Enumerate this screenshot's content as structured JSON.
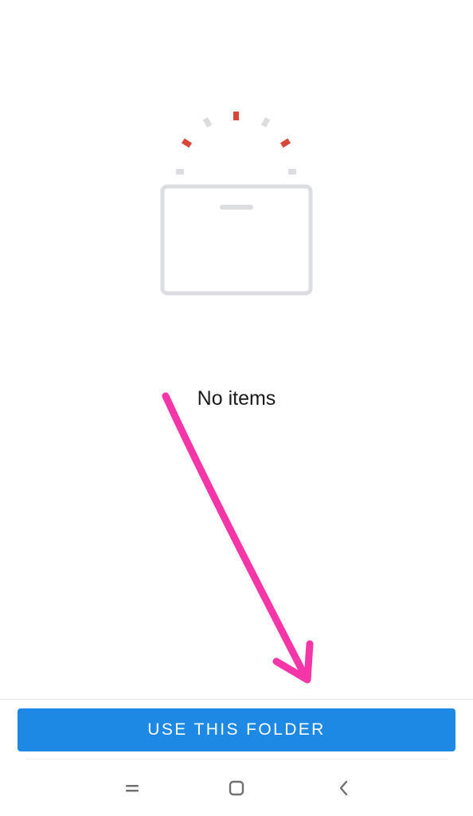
{
  "empty_state": {
    "message": "No items",
    "illustration_icon": "empty-folder-illustration-icon",
    "colors": {
      "outline": "#dcdde0",
      "accent": "#d9463a"
    }
  },
  "primary_action": {
    "label": "USE THIS FOLDER",
    "color": "#1e88e5"
  },
  "annotation": {
    "icon": "arrow-icon",
    "color": "#f535a8"
  },
  "nav_bar": {
    "buttons": [
      {
        "icon": "recents-icon"
      },
      {
        "icon": "home-icon"
      },
      {
        "icon": "back-icon"
      }
    ]
  }
}
